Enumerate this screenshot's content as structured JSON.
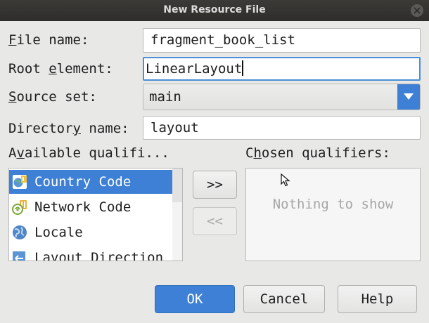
{
  "dialog": {
    "title": "New Resource File"
  },
  "form": {
    "file_name": {
      "label_mnemonic": "F",
      "label_rest": "ile name:",
      "value": "fragment_book_list"
    },
    "root_element": {
      "label_pre": "Root ",
      "label_mnemonic": "e",
      "label_rest": "lement:",
      "value": "LinearLayout"
    },
    "source_set": {
      "label_mnemonic": "S",
      "label_rest": "ource set:",
      "value": "main"
    },
    "directory_name": {
      "label_pre": "Director",
      "label_mnemonic": "y",
      "label_rest": " name:",
      "value": "layout"
    }
  },
  "qualifiers": {
    "available_label_pre": "A",
    "available_label_mnemonic": "v",
    "available_label_rest": "ailable qualifi...",
    "chosen_label_pre": "C",
    "chosen_label_mnemonic": "h",
    "chosen_label_rest": "osen qualifiers:",
    "available_items": [
      {
        "label": "Country Code",
        "icon": "country-code-icon",
        "selected": true
      },
      {
        "label": "Network Code",
        "icon": "network-code-icon",
        "selected": false
      },
      {
        "label": "Locale",
        "icon": "globe-icon",
        "selected": false
      },
      {
        "label": "Layout Direction",
        "icon": "layout-direction-icon",
        "selected": false
      }
    ],
    "add_button": ">>",
    "remove_button": "<<",
    "empty_text": "Nothing to show"
  },
  "buttons": {
    "ok": "OK",
    "cancel": "Cancel",
    "help": "Help"
  },
  "colors": {
    "accent": "#3d80d5",
    "titlebar": "#2e2d2b",
    "background": "#e8e8e7"
  }
}
